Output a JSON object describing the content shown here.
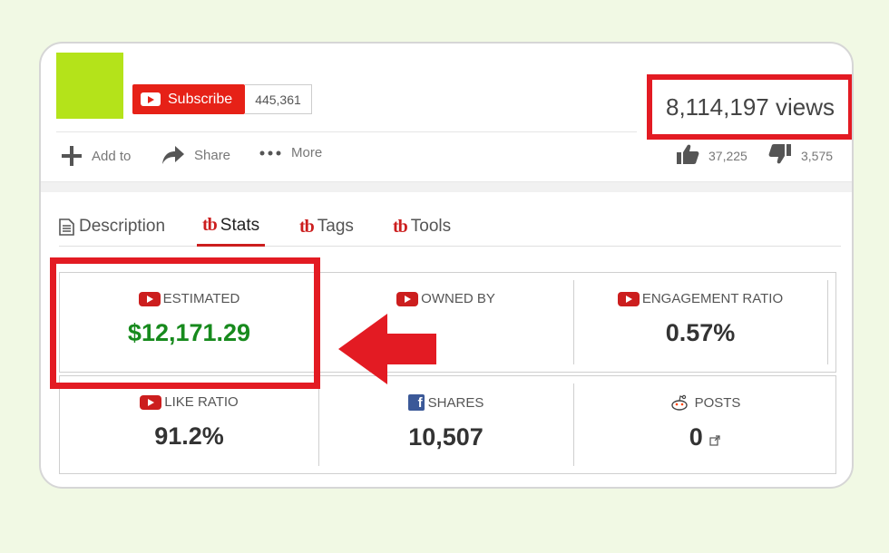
{
  "channel": {
    "subscribe_label": "Subscribe",
    "subscriber_count": "445,361"
  },
  "video": {
    "views": "8,114,197 views",
    "likes": "37,225",
    "dislikes": "3,575"
  },
  "actions": [
    {
      "label": "Add to",
      "icon": "plus-icon"
    },
    {
      "label": "Share",
      "icon": "share-arrow-icon"
    },
    {
      "label": "More",
      "icon": "more-dots-icon"
    }
  ],
  "tabs": [
    {
      "label": "Description",
      "icon": "document-icon"
    },
    {
      "label": "Stats",
      "icon": "tubebuddy-icon",
      "active": true
    },
    {
      "label": "Tags",
      "icon": "tubebuddy-icon"
    },
    {
      "label": "Tools",
      "icon": "tubebuddy-icon"
    }
  ],
  "tubebuddy_glyph": "tb",
  "stats": {
    "estimated": {
      "label": "ESTIMATED",
      "value": "$12,171.29"
    },
    "owned_by": {
      "label": "OWNED BY",
      "value": ""
    },
    "engagement": {
      "label": "ENGAGEMENT RATIO",
      "value": "0.57%"
    },
    "like_ratio": {
      "label": "LIKE RATIO",
      "value": "91.2%"
    },
    "shares": {
      "label": "SHARES",
      "value": "10,507"
    },
    "posts": {
      "label": "POSTS",
      "value": "0"
    }
  },
  "colors": {
    "accent_red": "#e31b23",
    "youtube_red": "#e62117",
    "money_green": "#178a1d",
    "avatar_green": "#b4e31a"
  }
}
